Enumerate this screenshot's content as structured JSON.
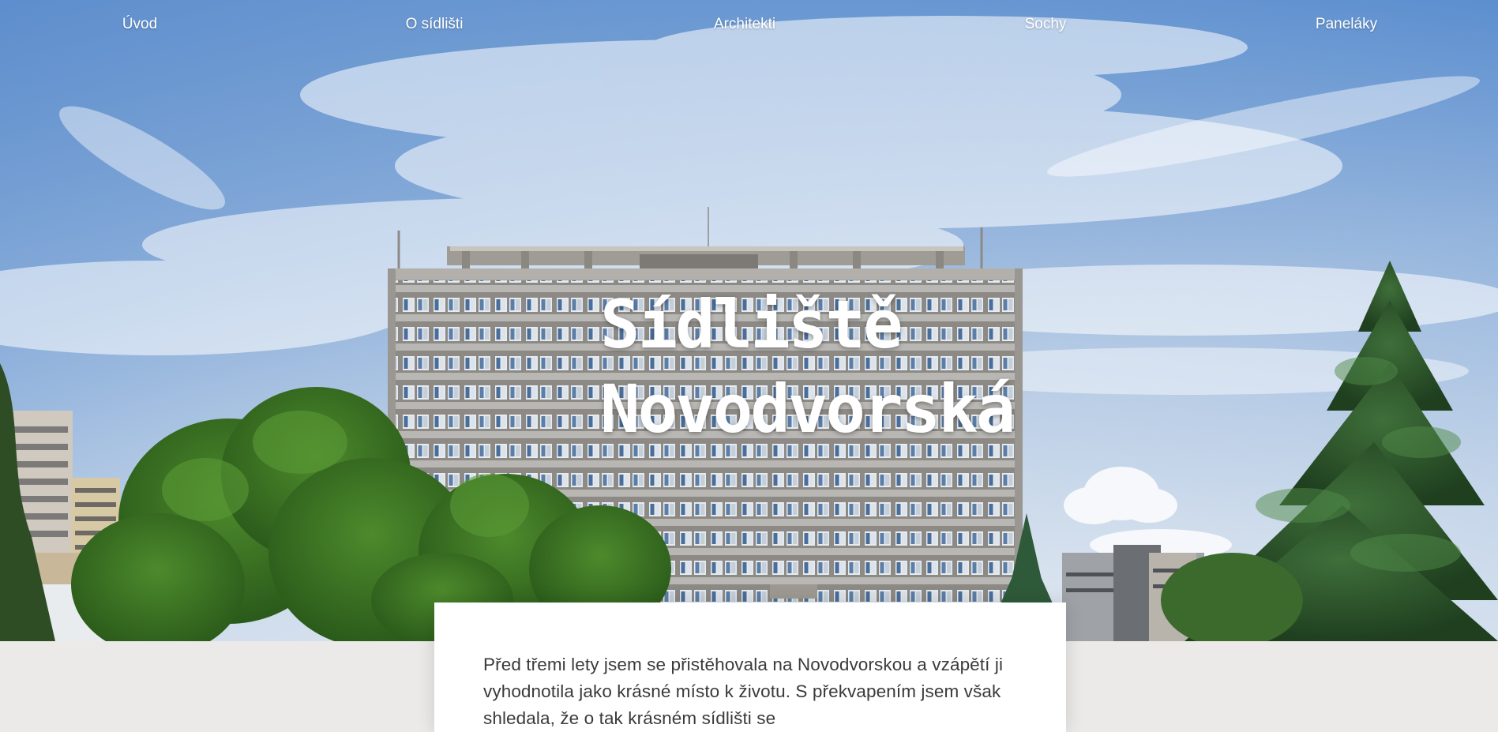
{
  "nav": {
    "items": [
      {
        "label": "Úvod"
      },
      {
        "label": "O sídlišti"
      },
      {
        "label": "Architekti"
      },
      {
        "label": "Sochy"
      },
      {
        "label": "Paneláky"
      }
    ]
  },
  "hero": {
    "title_line1": "Sídliště",
    "title_line2": "Novodvorská",
    "image_description": "panelový dům"
  },
  "intro": {
    "text": "Před třemi lety jsem se přistěhovala na Novodvorskou a vzápětí ji vyhodnotila jako krásné místo k životu. S překvapením jsem však shledala, že o tak krásném sídlišti se"
  },
  "colors": {
    "page_background": "#ebeae8",
    "card_background": "#ffffff",
    "text": "#3a3a3a",
    "hero_text": "#ffffff"
  }
}
